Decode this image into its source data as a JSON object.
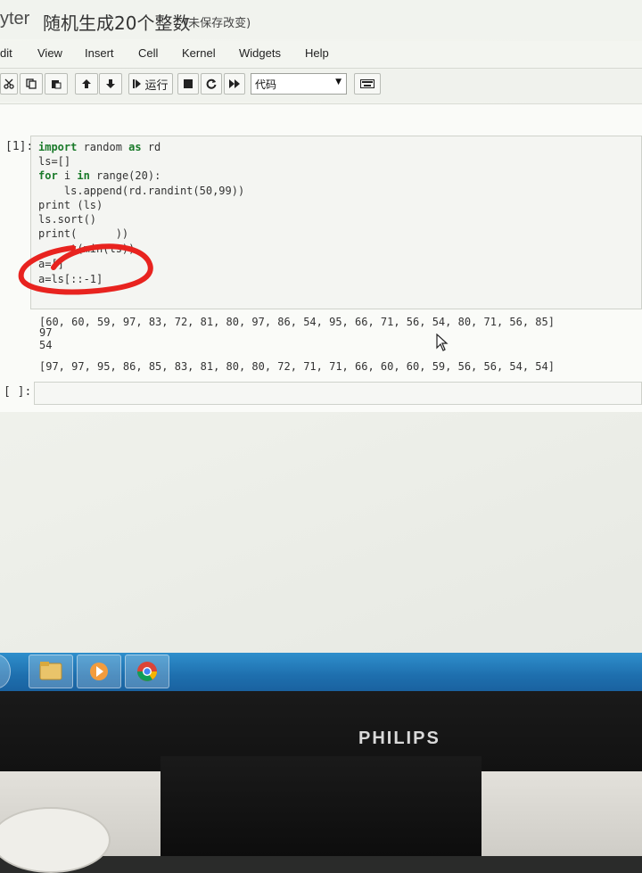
{
  "header": {
    "logo_text": "yter",
    "notebook_title": "随机生成20个整数",
    "save_status": "(未保存改变)"
  },
  "menu": {
    "items": [
      "dit",
      "View",
      "Insert",
      "Cell",
      "Kernel",
      "Widgets",
      "Help"
    ]
  },
  "toolbar": {
    "run_label": "运行",
    "cell_type_value": "代码",
    "icons": [
      "cut-icon",
      "copy-icon",
      "paste-icon",
      "move-up-icon",
      "move-down-icon",
      "run-icon",
      "stop-icon",
      "restart-icon",
      "fast-forward-icon",
      "keyboard-icon"
    ]
  },
  "cells": [
    {
      "prompt": "[1]:",
      "code_lines": [
        "import random as rd",
        "ls=[]",
        "for i in range(20):",
        "    ls.append(rd.randint(50,99))",
        "print (ls)",
        "ls.sort()",
        "print(      ))",
        "     t(min(ls))",
        "a=[]",
        "a=ls[::-1]"
      ],
      "output_lines": [
        "[60, 60, 59, 97, 83, 72, 81, 80, 97, 86, 54, 95, 66, 71, 56, 54, 80, 71, 56, 85]",
        "97",
        "54",
        "[97, 97, 95, 86, 85, 83, 81, 80, 80, 72, 71, 71, 66, 60, 60, 59, 56, 56, 54, 54]"
      ]
    },
    {
      "prompt": "[ ]:",
      "code_lines": []
    }
  ],
  "taskbar": {
    "apps": [
      "start-orb-icon",
      "file-explorer-icon",
      "media-player-icon",
      "chrome-icon"
    ]
  },
  "monitor": {
    "brand": "PHILIPS"
  },
  "colors": {
    "keyword": "#1a7a2a",
    "annotation": "#e8231f",
    "taskbar": "#2a86c6"
  }
}
